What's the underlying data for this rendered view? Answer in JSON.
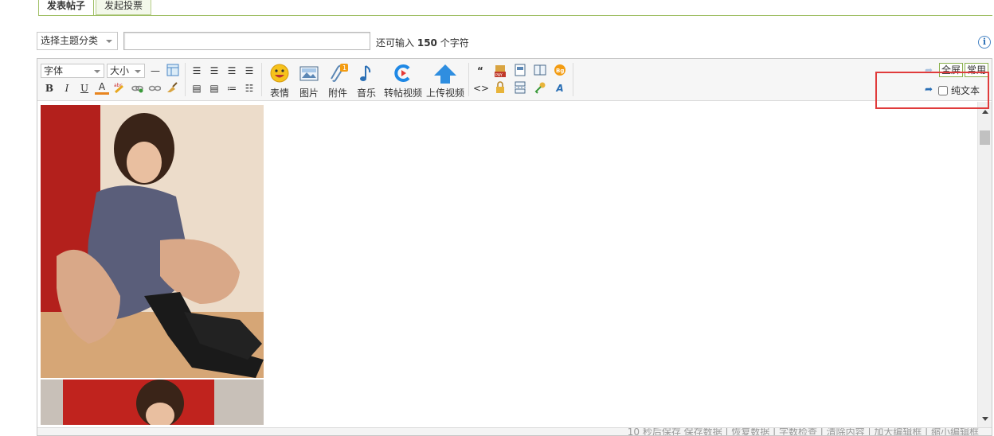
{
  "tabs": [
    {
      "label": "发表帖子",
      "active": true
    },
    {
      "label": "发起投票",
      "active": false
    }
  ],
  "subject": {
    "category_placeholder": "选择主题分类",
    "title_value": "",
    "counter_prefix": "还可输入",
    "counter_value": "150",
    "counter_suffix": "个字符"
  },
  "toolbar": {
    "font_label": "字体",
    "size_label": "大小",
    "smiley_label": "表情",
    "image_label": "图片",
    "attach_label": "附件",
    "music_label": "音乐",
    "repost_video_label": "转帖视频",
    "upload_video_label": "上传视频",
    "bold": "B",
    "italic": "I",
    "underline": "U",
    "fontcolor": "A",
    "fullscreen_label": "全屏",
    "common_label": "常用",
    "plaintext_label": "纯文本"
  },
  "statusbar": {
    "text": "10 秒后保存 保存数据 | 恢复数据 | 字数检查 | 清除内容 | 加大编辑框 | 缩小编辑框"
  },
  "colors": {
    "tab_border": "#9fbf64",
    "highlight": "#e03b3b",
    "link_blue": "#2a6fb5"
  }
}
